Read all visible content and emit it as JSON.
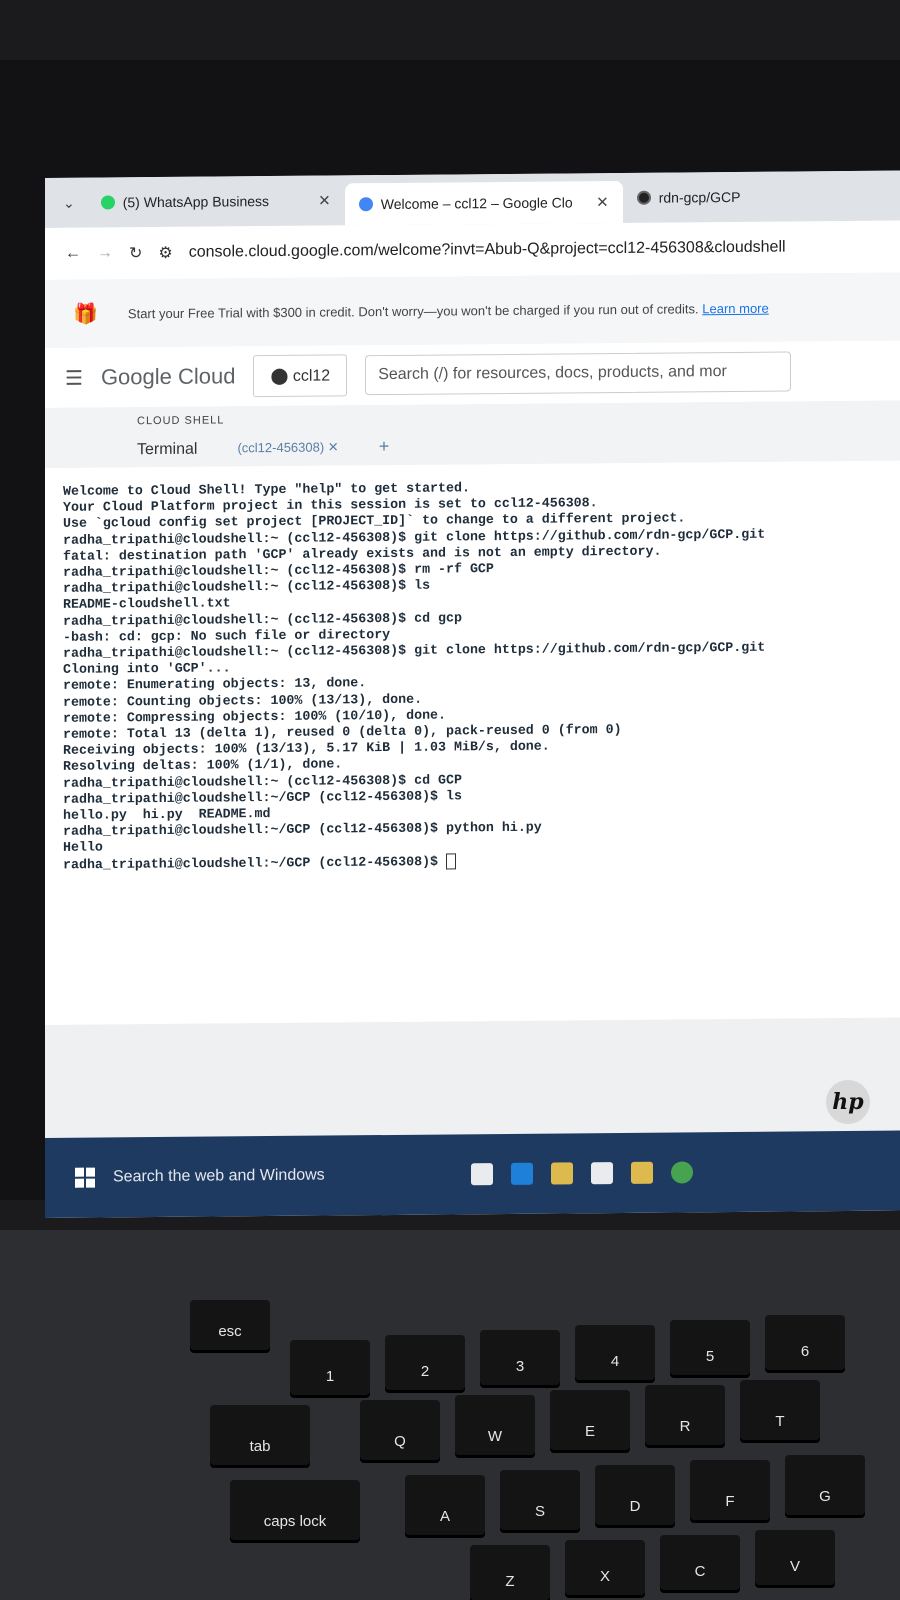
{
  "browser": {
    "tabs": [
      {
        "label": "(5) WhatsApp Business",
        "icon": "whatsapp-icon"
      },
      {
        "label": "Welcome – ccl12 – Google Clo",
        "icon": "google-cloud-icon"
      },
      {
        "label": "rdn-gcp/GCP",
        "icon": "github-icon"
      }
    ],
    "url": "console.cloud.google.com/welcome?invt=Abub-Q&project=ccl12-456308&cloudshell"
  },
  "banner": {
    "text": "Start your Free Trial with $300 in credit. Don't worry—you won't be charged if you run out of credits.",
    "link": "Learn more"
  },
  "header": {
    "logo": "Google Cloud",
    "project": "ccl12",
    "search_placeholder": "Search (/) for resources, docs, products, and mor"
  },
  "shell": {
    "section_label": "CLOUD SHELL",
    "tab_terminal": "Terminal",
    "session_tab": "(ccl12-456308)",
    "add": "+"
  },
  "terminal_lines": [
    "Welcome to Cloud Shell! Type \"help\" to get started.",
    "Your Cloud Platform project in this session is set to ccl12-456308.",
    "Use `gcloud config set project [PROJECT_ID]` to change to a different project.",
    "radha_tripathi@cloudshell:~ (ccl12-456308)$ git clone https://github.com/rdn-gcp/GCP.git",
    "fatal: destination path 'GCP' already exists and is not an empty directory.",
    "radha_tripathi@cloudshell:~ (ccl12-456308)$ rm -rf GCP",
    "radha_tripathi@cloudshell:~ (ccl12-456308)$ ls",
    "README-cloudshell.txt",
    "radha_tripathi@cloudshell:~ (ccl12-456308)$ cd gcp",
    "-bash: cd: gcp: No such file or directory",
    "radha_tripathi@cloudshell:~ (ccl12-456308)$ git clone https://github.com/rdn-gcp/GCP.git",
    "Cloning into 'GCP'...",
    "remote: Enumerating objects: 13, done.",
    "remote: Counting objects: 100% (13/13), done.",
    "remote: Compressing objects: 100% (10/10), done.",
    "remote: Total 13 (delta 1), reused 0 (delta 0), pack-reused 0 (from 0)",
    "Receiving objects: 100% (13/13), 5.17 KiB | 1.03 MiB/s, done.",
    "Resolving deltas: 100% (1/1), done.",
    "radha_tripathi@cloudshell:~ (ccl12-456308)$ cd GCP",
    "radha_tripathi@cloudshell:~/GCP (ccl12-456308)$ ls",
    "hello.py  hi.py  README.md",
    "radha_tripathi@cloudshell:~/GCP (ccl12-456308)$ python hi.py",
    "Hello",
    "radha_tripathi@cloudshell:~/GCP (ccl12-456308)$ "
  ],
  "taskbar": {
    "search": "Search the web and Windows"
  },
  "brand": "hp",
  "keys": {
    "esc": "esc",
    "tab": "tab",
    "caps": "caps lock",
    "n1": "1",
    "n2": "2",
    "n3": "3",
    "n4": "4",
    "n5": "5",
    "n6": "6",
    "q": "Q",
    "w": "W",
    "e": "E",
    "r": "R",
    "t": "T",
    "a": "A",
    "s": "S",
    "d": "D",
    "f": "F",
    "g": "G",
    "z": "Z",
    "x": "X",
    "c": "C",
    "v": "V"
  }
}
